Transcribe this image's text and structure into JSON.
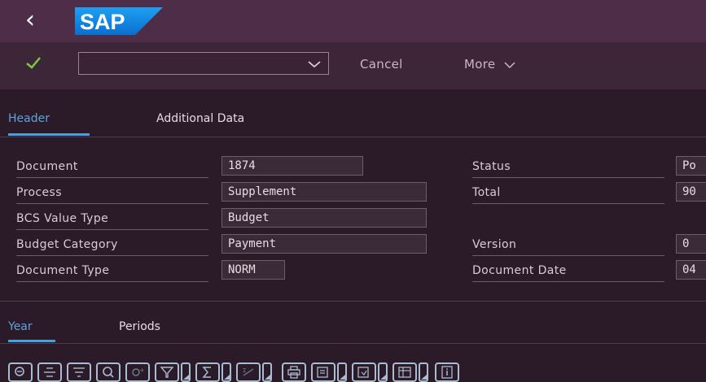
{
  "shell": {
    "back_icon": "chevron-left-icon",
    "logo_text": "SAP",
    "brand_color": "#1f8fe6"
  },
  "toolbar": {
    "confirm_icon": "checkmark-icon",
    "variant_value": "",
    "cancel_label": "Cancel",
    "more_label": "More"
  },
  "header_tabs": [
    {
      "label": "Header",
      "active": true
    },
    {
      "label": "Additional Data",
      "active": false
    }
  ],
  "form_left": [
    {
      "label": "Document",
      "value": "1874"
    },
    {
      "label": "Process",
      "value": "Supplement"
    },
    {
      "label": "BCS Value Type",
      "value": "Budget"
    },
    {
      "label": "Budget Category",
      "value": "Payment"
    },
    {
      "label": "Document Type",
      "value": "NORM"
    }
  ],
  "form_right": [
    {
      "label": "Status",
      "value": "Po"
    },
    {
      "label": "Total",
      "value": "90"
    },
    {
      "label": "Version",
      "value": "0"
    },
    {
      "label": "Document Date",
      "value": "04"
    }
  ],
  "detail_tabs": [
    {
      "label": "Year",
      "active": true
    },
    {
      "label": "Periods",
      "active": false
    }
  ],
  "grid_toolbar": [
    "search-row-icon",
    "align-center-icon",
    "filter-lines-icon",
    "find-icon",
    "find-next-icon",
    "filter-icon",
    "sum-icon",
    "subtotal-icon",
    "print-icon",
    "export-icon",
    "layout-icon",
    "view-icon",
    "info-icon"
  ],
  "colors": {
    "shell_bg": "#4d2d47",
    "page_bg": "#2b1a28",
    "accent": "#4a9fe0",
    "confirm": "#7ccc3a"
  }
}
